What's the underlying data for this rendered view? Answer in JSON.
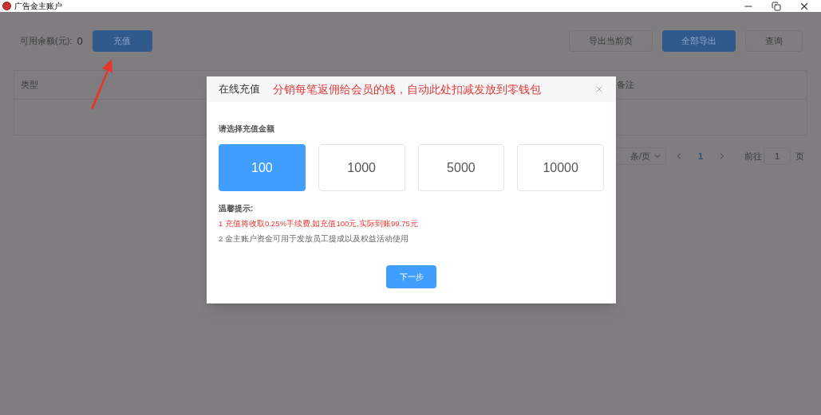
{
  "window": {
    "title": "广告金主账户",
    "controls": [
      {
        "kind": "minimize"
      },
      {
        "kind": "restore"
      },
      {
        "kind": "close"
      }
    ]
  },
  "balance": {
    "label": "可用余额(元):",
    "value": "0",
    "button": "充值"
  },
  "actions": [
    {
      "label": "导出当前页",
      "primary": false
    },
    {
      "label": "全部导出",
      "primary": true
    },
    {
      "label": "查询",
      "primary": false
    }
  ],
  "table": {
    "columns": [
      {
        "label": "类型"
      },
      {
        "label": "备注"
      }
    ]
  },
  "pagination": {
    "page_size": "条/页",
    "pages": [
      {
        "label": "1",
        "selected": true
      }
    ],
    "goto_label": "前往",
    "goto_value": "1",
    "goto_suffix": "页"
  },
  "dialog": {
    "title": "在线充值",
    "annotation": "分销每笔返佣给会员的钱，自动此处扣减发放到零钱包",
    "prompt": "请选择充值金额",
    "amounts": [
      {
        "label": "100",
        "selected": true
      },
      {
        "label": "1000",
        "selected": false
      },
      {
        "label": "5000",
        "selected": false
      },
      {
        "label": "10000",
        "selected": false
      }
    ],
    "tips_title": "温馨提示:",
    "tips": [
      {
        "text": "1 充值将收取0.25%手续费,如充值100元,实际到账99.75元",
        "warning": true
      },
      {
        "text": "2 金主账户资金可用于发放员工提成以及权益活动使用",
        "warning": false
      }
    ],
    "next_button": "下一步"
  }
}
